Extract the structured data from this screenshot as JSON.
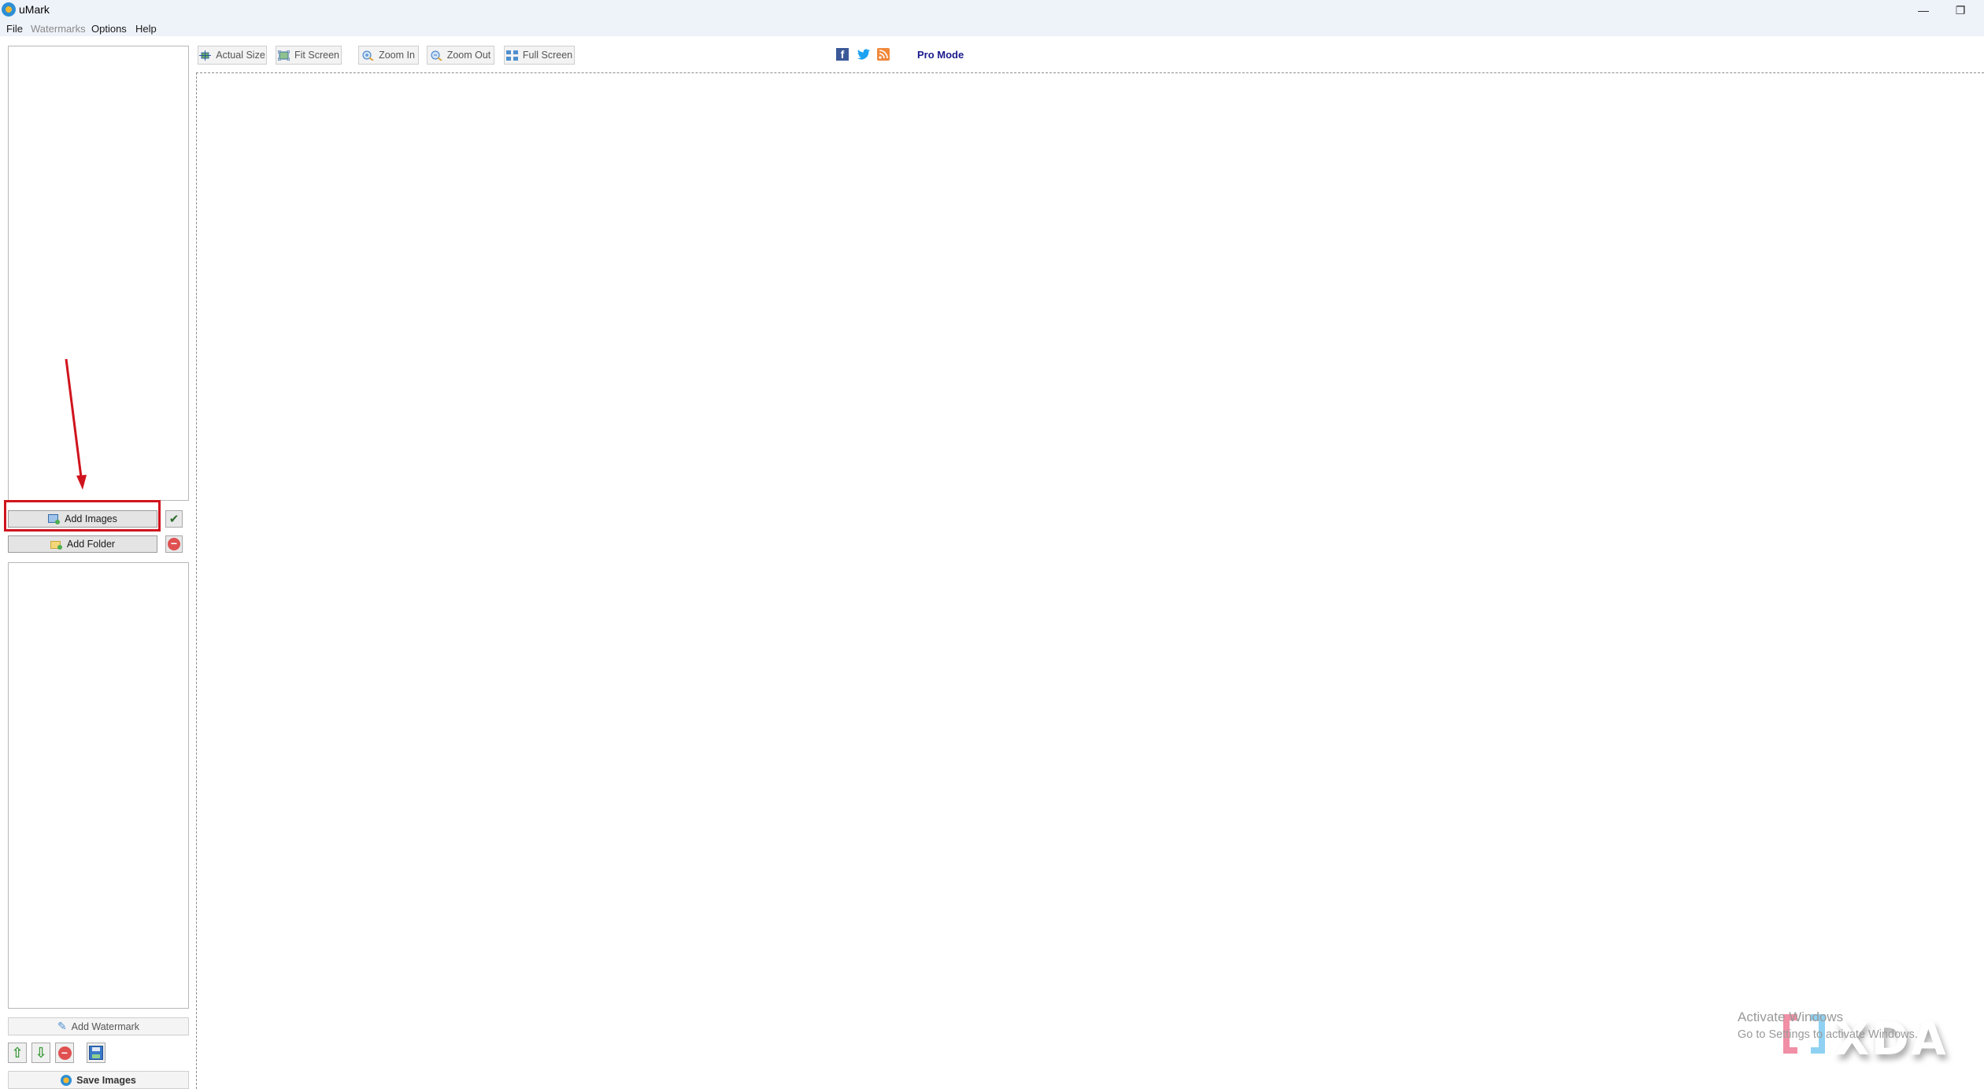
{
  "window": {
    "title": "uMark",
    "controls": {
      "minimize": "—",
      "restore": "❐"
    }
  },
  "menu": {
    "items": [
      {
        "label": "File",
        "enabled": true
      },
      {
        "label": "Watermarks",
        "enabled": false
      },
      {
        "label": "Options",
        "enabled": true
      },
      {
        "label": "Help",
        "enabled": true
      }
    ]
  },
  "toolbar": {
    "buttons": [
      {
        "label": "Actual Size",
        "icon": "actual-size-icon"
      },
      {
        "label": "Fit Screen",
        "icon": "fit-screen-icon"
      },
      {
        "label": "Zoom In",
        "icon": "zoom-in-icon"
      },
      {
        "label": "Zoom Out",
        "icon": "zoom-out-icon"
      },
      {
        "label": "Full Screen",
        "icon": "full-screen-icon"
      }
    ],
    "social": [
      {
        "name": "facebook",
        "glyph": "f",
        "color": "#3b5998"
      },
      {
        "name": "twitter",
        "glyph": "🐦",
        "color": "#1da1f2"
      },
      {
        "name": "rss",
        "glyph": "◔",
        "color": "#f0883a"
      }
    ],
    "pro_mode_label": "Pro Mode"
  },
  "left_panel": {
    "add_images_label": "Add Images",
    "add_folder_label": "Add Folder",
    "select_all_glyph": "✔",
    "remove_glyph": "−",
    "add_watermark_label": "Add Watermark",
    "save_images_label": "Save Images",
    "watermark_actions": [
      {
        "name": "move-up",
        "glyph": "⇧"
      },
      {
        "name": "move-down",
        "glyph": "⇩"
      },
      {
        "name": "remove-watermark",
        "glyph": "−"
      },
      {
        "name": "save-watermark",
        "glyph": "💾"
      }
    ]
  },
  "annotation": {
    "highlight_target": "Add Images",
    "color": "#d0141d"
  },
  "overlay": {
    "activate_title": "Activate Windows",
    "activate_sub": "Go to Settings to activate Windows.",
    "xda_logo": "XDA"
  }
}
